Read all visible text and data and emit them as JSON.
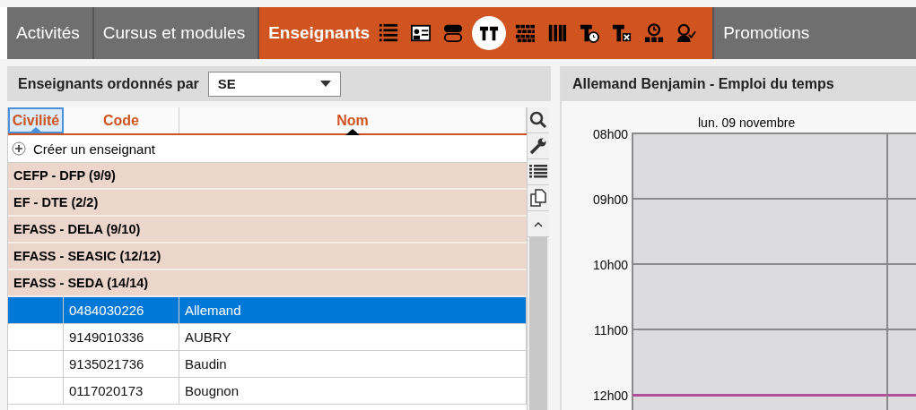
{
  "tabs": [
    {
      "label": "Activités",
      "selected": false
    },
    {
      "label": "Cursus et modules",
      "selected": false
    },
    {
      "label": "Enseignants",
      "selected": true,
      "icons": [
        {
          "kind": "list",
          "selected": false
        },
        {
          "kind": "card",
          "selected": false
        },
        {
          "kind": "pills",
          "selected": false
        },
        {
          "kind": "tt",
          "selected": true
        },
        {
          "kind": "wall",
          "selected": false
        },
        {
          "kind": "columns",
          "selected": false
        },
        {
          "kind": "tclock",
          "selected": false
        },
        {
          "kind": "tx",
          "selected": false
        },
        {
          "kind": "clockgroup",
          "selected": false
        },
        {
          "kind": "personcheck",
          "selected": false
        }
      ]
    },
    {
      "label": "Promotions",
      "selected": false
    }
  ],
  "list_panel": {
    "sort_label": "Enseignants ordonnés par",
    "sort_value": "SE",
    "columns": [
      {
        "label": "Civilité",
        "selected": true
      },
      {
        "label": "Code",
        "selected": false
      },
      {
        "label": "Nom",
        "selected": false
      }
    ],
    "create_label": "Créer un enseignant",
    "rows": [
      {
        "kind": "group",
        "label": "CEFP - DFP (9/9)"
      },
      {
        "kind": "group",
        "label": "EF - DTE (2/2)"
      },
      {
        "kind": "group",
        "label": "EFASS - DELA (9/10)"
      },
      {
        "kind": "group",
        "label": "EFASS - SEASIC (12/12)"
      },
      {
        "kind": "group",
        "label": "EFASS - SEDA (14/14)"
      },
      {
        "kind": "teacher",
        "code": "0484030226",
        "name": "Allemand",
        "selected": true
      },
      {
        "kind": "teacher",
        "code": "9149010336",
        "name": "AUBRY",
        "selected": false
      },
      {
        "kind": "teacher",
        "code": "9135021736",
        "name": "Baudin",
        "selected": false
      },
      {
        "kind": "teacher",
        "code": "0117020173",
        "name": "Bougnon",
        "selected": false
      }
    ]
  },
  "timetable": {
    "title": "Allemand Benjamin - Emploi du temps",
    "day": "lun. 09 novembre",
    "hours": [
      {
        "label": "08h00",
        "highlighted": false
      },
      {
        "label": "09h00",
        "highlighted": false
      },
      {
        "label": "10h00",
        "highlighted": false
      },
      {
        "label": "11h00",
        "highlighted": false
      },
      {
        "label": "12h00",
        "highlighted": true
      }
    ]
  }
}
